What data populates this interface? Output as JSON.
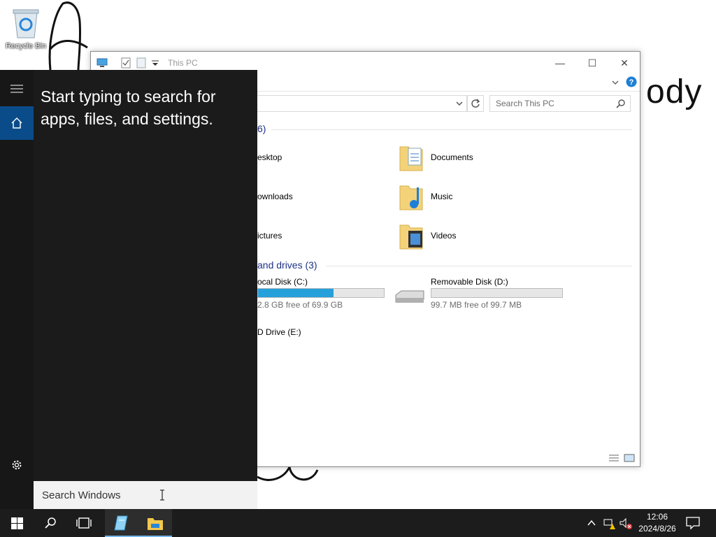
{
  "desktop": {
    "recycle_bin_label": "Recycle Bin",
    "doodle_text": "ody"
  },
  "explorer": {
    "title": "This PC",
    "search_placeholder": "Search This PC",
    "folders_header": "6)",
    "folders": [
      {
        "label": "esktop",
        "icon": "desktop-folder-icon"
      },
      {
        "label": "Documents",
        "icon": "documents-folder-icon"
      },
      {
        "label": "ownloads",
        "icon": "downloads-folder-icon"
      },
      {
        "label": "Music",
        "icon": "music-folder-icon"
      },
      {
        "label": "ictures",
        "icon": "pictures-folder-icon"
      },
      {
        "label": "Videos",
        "icon": "videos-folder-icon"
      }
    ],
    "drives_header": "and drives (3)",
    "drives": [
      {
        "label": "ocal Disk (C:)",
        "free": "2.8 GB free of 69.9 GB",
        "used_fraction": 0.6
      },
      {
        "label": "Removable Disk (D:)",
        "free": "99.7 MB free of 99.7 MB",
        "used_fraction": 0.0
      },
      {
        "label": "D Drive (E:)"
      }
    ]
  },
  "start": {
    "message": "Start typing to search for apps, files, and settings.",
    "search_placeholder": "Search Windows"
  },
  "taskbar": {
    "time": "12:06",
    "date": "2024/8/26"
  },
  "colors": {
    "accent": "#0a4c8a",
    "drive_bar": "#26a0da"
  }
}
